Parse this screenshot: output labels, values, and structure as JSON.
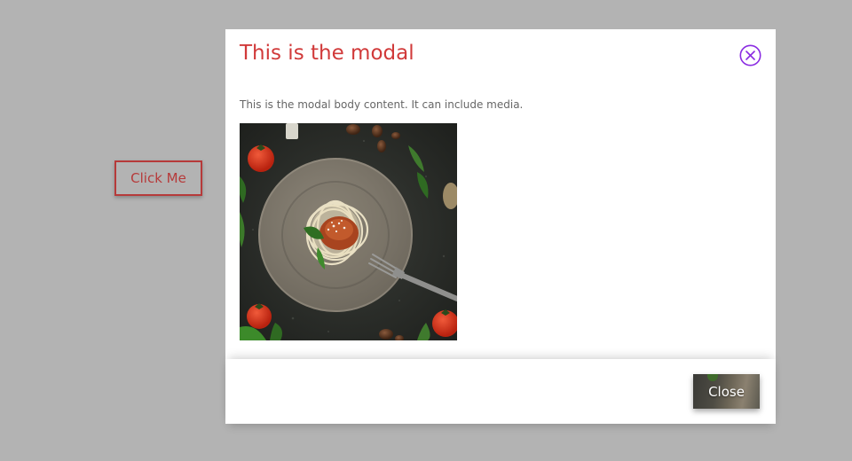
{
  "trigger": {
    "label": "Click Me"
  },
  "modal": {
    "title": "This is the modal",
    "body_text": "This is the modal body content. It can include media.",
    "close_icon": "close-circle-icon",
    "media_description": "plate-of-pasta-image",
    "footer": {
      "close_label": "Close"
    }
  },
  "colors": {
    "backdrop": "#b3b3b3",
    "title": "#d13a3a",
    "trigger_border": "#b63a3a",
    "close_icon": "#8a2be2"
  }
}
